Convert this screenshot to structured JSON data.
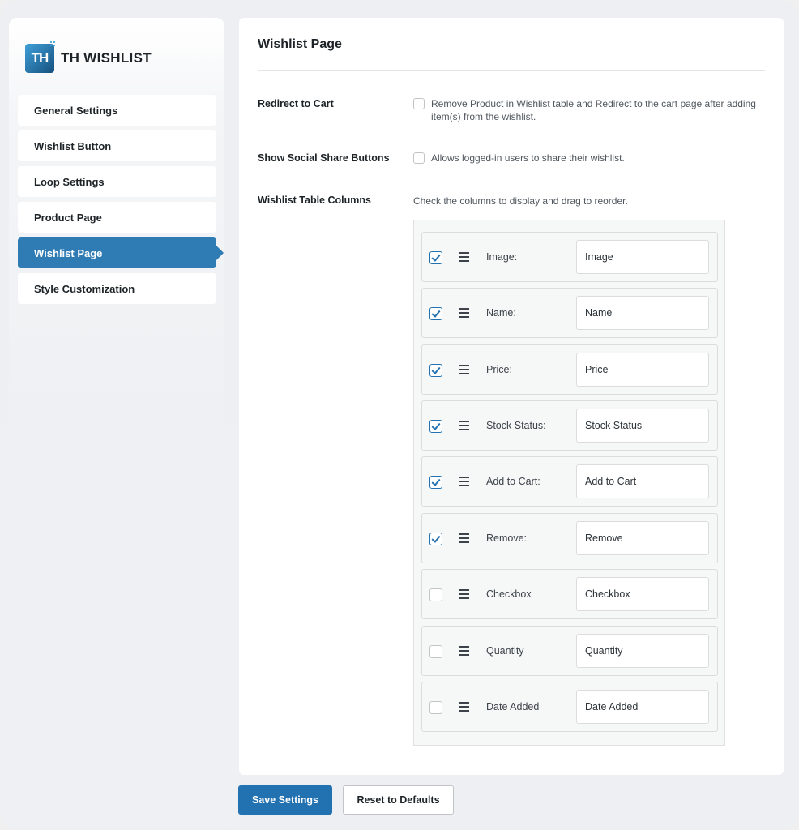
{
  "brand": {
    "logo_text": "TH",
    "name": "TH WISHLIST"
  },
  "sidebar": {
    "items": [
      {
        "label": "General Settings",
        "active": false
      },
      {
        "label": "Wishlist Button",
        "active": false
      },
      {
        "label": "Loop Settings",
        "active": false
      },
      {
        "label": "Product Page",
        "active": false
      },
      {
        "label": "Wishlist Page",
        "active": true
      },
      {
        "label": "Style Customization",
        "active": false
      }
    ]
  },
  "page": {
    "title": "Wishlist Page",
    "redirect": {
      "label": "Redirect to Cart",
      "checked": false,
      "description": "Remove Product in Wishlist table and Redirect to the cart page after adding item(s) from the wishlist."
    },
    "social": {
      "label": "Show Social Share Buttons",
      "checked": false,
      "description": "Allows logged-in users to share their wishlist."
    },
    "columns": {
      "label": "Wishlist Table Columns",
      "hint": "Check the columns to display and drag to reorder.",
      "items": [
        {
          "label": "Image:",
          "value": "Image",
          "checked": true
        },
        {
          "label": "Name:",
          "value": "Name",
          "checked": true
        },
        {
          "label": "Price:",
          "value": "Price",
          "checked": true
        },
        {
          "label": "Stock Status:",
          "value": "Stock Status",
          "checked": true
        },
        {
          "label": "Add to Cart:",
          "value": "Add to Cart",
          "checked": true
        },
        {
          "label": "Remove:",
          "value": "Remove",
          "checked": true
        },
        {
          "label": "Checkbox",
          "value": "Checkbox",
          "checked": false
        },
        {
          "label": "Quantity",
          "value": "Quantity",
          "checked": false
        },
        {
          "label": "Date Added",
          "value": "Date Added",
          "checked": false
        }
      ]
    }
  },
  "footer": {
    "save_label": "Save Settings",
    "reset_label": "Reset to Defaults"
  },
  "colors": {
    "accent": "#2271b1",
    "active_nav": "#2f7cb5"
  }
}
